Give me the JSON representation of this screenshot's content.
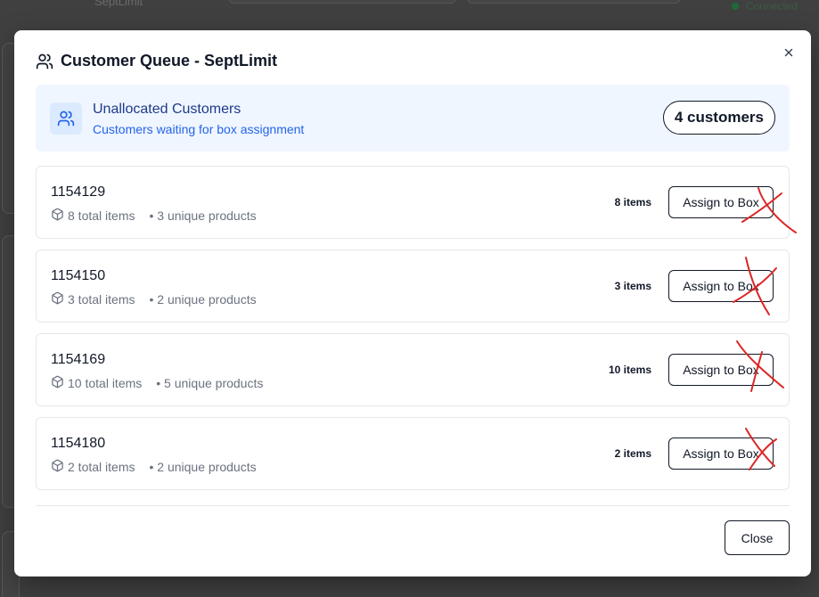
{
  "background": {
    "label": "SeptLimit",
    "status": "Connected"
  },
  "modal": {
    "title": "Customer Queue - SeptLimit",
    "summary": {
      "title": "Unallocated Customers",
      "subtitle": "Customers waiting for box assignment",
      "count_badge": "4 customers"
    },
    "customers": [
      {
        "id": "1154129",
        "total_items": "8 total items",
        "unique_products": "• 3 unique products",
        "items_badge": "8 items",
        "assign_label": "Assign to Box"
      },
      {
        "id": "1154150",
        "total_items": "3 total items",
        "unique_products": "• 2 unique products",
        "items_badge": "3 items",
        "assign_label": "Assign to Box"
      },
      {
        "id": "1154169",
        "total_items": "10 total items",
        "unique_products": "• 5 unique products",
        "items_badge": "10 items",
        "assign_label": "Assign to Box"
      },
      {
        "id": "1154180",
        "total_items": "2 total items",
        "unique_products": "• 2 unique products",
        "items_badge": "2 items",
        "assign_label": "Assign to Box"
      }
    ],
    "close_label": "Close"
  },
  "colors": {
    "summary_bg": "#eff6ff",
    "summary_title": "#1e3a8a",
    "summary_subtitle": "#2563eb",
    "annotation_strike": "#dc2626",
    "status_dot": "#1f6b38"
  },
  "icons": {
    "header": "users-icon",
    "summary": "users-icon",
    "close": "close-icon",
    "item": "package-icon",
    "annotation": "red-x-mark"
  }
}
